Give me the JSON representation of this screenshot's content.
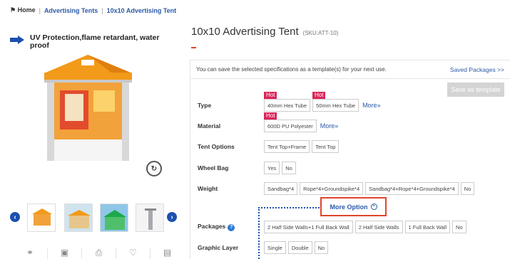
{
  "breadcrumb": {
    "home": "Home",
    "sep1": "|",
    "level1": "Advertising Tents",
    "sep2": "|",
    "level2": "10x10 Advertising Tent"
  },
  "feature": {
    "text": "UV Protection,flame retardant, water proof"
  },
  "product": {
    "title": "10x10 Advertising Tent",
    "sku": "(SKU:ATT-10)"
  },
  "panel": {
    "info_text": "You can save the selected specifications as a template(s) for your next use.",
    "saved_packages": "Saved Packages >>",
    "save_template": "Save as template",
    "hot_label": "Hot",
    "more_label": "More»",
    "more_option": "More Option",
    "rows": {
      "type": {
        "label": "Type",
        "options": [
          "40mm Hex Tube",
          "50mm Hex Tube"
        ]
      },
      "material": {
        "label": "Material",
        "options": [
          "600D PU Polyester"
        ]
      },
      "tent_options": {
        "label": "Tent Options",
        "options": [
          "Tent Top+Frame",
          "Tent Top"
        ]
      },
      "wheel_bag": {
        "label": "Wheel Bag",
        "options": [
          "Yes",
          "No"
        ]
      },
      "weight": {
        "label": "Weight",
        "options": [
          "Sandbag*4",
          "Rope*4+Groundspike*4",
          "Sandbag*4+Rope*4+Groundspike*4",
          "No"
        ]
      },
      "packages": {
        "label": "Packages",
        "options": [
          "2 Half Side Walls+1 Full Back Wall",
          "2 Half Side Walls",
          "1 Full Back Wall",
          "No"
        ]
      },
      "graphic_layer": {
        "label": "Graphic Layer",
        "options": [
          "Single",
          "Double",
          "No"
        ]
      }
    }
  },
  "icons": [
    "home-icon",
    "arrow-right-icon",
    "rotate-360-icon",
    "chevron-left-icon",
    "chevron-right-icon",
    "share-icon",
    "image-icon",
    "print-icon",
    "heart-icon",
    "pdf-icon",
    "help-icon",
    "collapse-icon"
  ],
  "colors": {
    "accent": "#1c4fae",
    "link": "#2b5aa8",
    "hot": "#d8265a",
    "highlight": "#e0452b",
    "tent_orange": "#f29a1a"
  }
}
